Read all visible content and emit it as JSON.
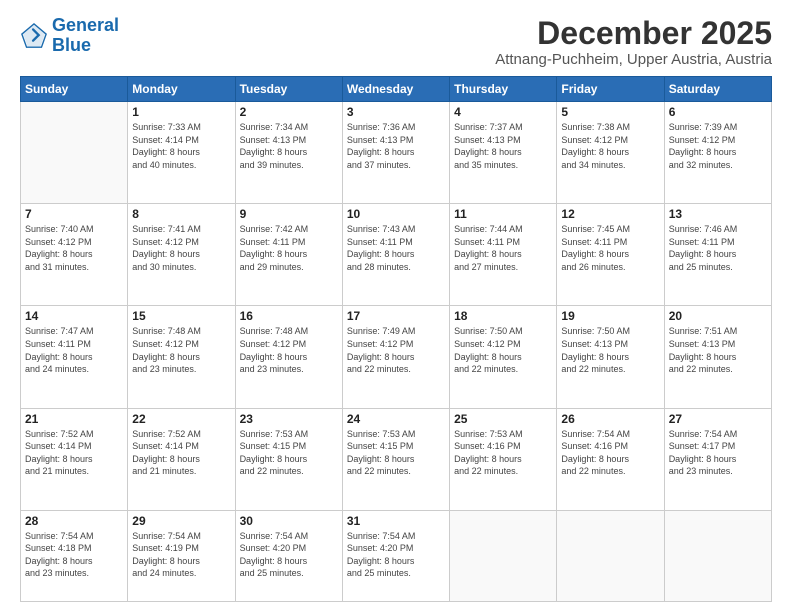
{
  "logo": {
    "line1": "General",
    "line2": "Blue"
  },
  "header": {
    "month": "December 2025",
    "location": "Attnang-Puchheim, Upper Austria, Austria"
  },
  "weekdays": [
    "Sunday",
    "Monday",
    "Tuesday",
    "Wednesday",
    "Thursday",
    "Friday",
    "Saturday"
  ],
  "weeks": [
    [
      {
        "day": "",
        "info": ""
      },
      {
        "day": "1",
        "info": "Sunrise: 7:33 AM\nSunset: 4:14 PM\nDaylight: 8 hours\nand 40 minutes."
      },
      {
        "day": "2",
        "info": "Sunrise: 7:34 AM\nSunset: 4:13 PM\nDaylight: 8 hours\nand 39 minutes."
      },
      {
        "day": "3",
        "info": "Sunrise: 7:36 AM\nSunset: 4:13 PM\nDaylight: 8 hours\nand 37 minutes."
      },
      {
        "day": "4",
        "info": "Sunrise: 7:37 AM\nSunset: 4:13 PM\nDaylight: 8 hours\nand 35 minutes."
      },
      {
        "day": "5",
        "info": "Sunrise: 7:38 AM\nSunset: 4:12 PM\nDaylight: 8 hours\nand 34 minutes."
      },
      {
        "day": "6",
        "info": "Sunrise: 7:39 AM\nSunset: 4:12 PM\nDaylight: 8 hours\nand 32 minutes."
      }
    ],
    [
      {
        "day": "7",
        "info": "Sunrise: 7:40 AM\nSunset: 4:12 PM\nDaylight: 8 hours\nand 31 minutes."
      },
      {
        "day": "8",
        "info": "Sunrise: 7:41 AM\nSunset: 4:12 PM\nDaylight: 8 hours\nand 30 minutes."
      },
      {
        "day": "9",
        "info": "Sunrise: 7:42 AM\nSunset: 4:11 PM\nDaylight: 8 hours\nand 29 minutes."
      },
      {
        "day": "10",
        "info": "Sunrise: 7:43 AM\nSunset: 4:11 PM\nDaylight: 8 hours\nand 28 minutes."
      },
      {
        "day": "11",
        "info": "Sunrise: 7:44 AM\nSunset: 4:11 PM\nDaylight: 8 hours\nand 27 minutes."
      },
      {
        "day": "12",
        "info": "Sunrise: 7:45 AM\nSunset: 4:11 PM\nDaylight: 8 hours\nand 26 minutes."
      },
      {
        "day": "13",
        "info": "Sunrise: 7:46 AM\nSunset: 4:11 PM\nDaylight: 8 hours\nand 25 minutes."
      }
    ],
    [
      {
        "day": "14",
        "info": "Sunrise: 7:47 AM\nSunset: 4:11 PM\nDaylight: 8 hours\nand 24 minutes."
      },
      {
        "day": "15",
        "info": "Sunrise: 7:48 AM\nSunset: 4:12 PM\nDaylight: 8 hours\nand 23 minutes."
      },
      {
        "day": "16",
        "info": "Sunrise: 7:48 AM\nSunset: 4:12 PM\nDaylight: 8 hours\nand 23 minutes."
      },
      {
        "day": "17",
        "info": "Sunrise: 7:49 AM\nSunset: 4:12 PM\nDaylight: 8 hours\nand 22 minutes."
      },
      {
        "day": "18",
        "info": "Sunrise: 7:50 AM\nSunset: 4:12 PM\nDaylight: 8 hours\nand 22 minutes."
      },
      {
        "day": "19",
        "info": "Sunrise: 7:50 AM\nSunset: 4:13 PM\nDaylight: 8 hours\nand 22 minutes."
      },
      {
        "day": "20",
        "info": "Sunrise: 7:51 AM\nSunset: 4:13 PM\nDaylight: 8 hours\nand 22 minutes."
      }
    ],
    [
      {
        "day": "21",
        "info": "Sunrise: 7:52 AM\nSunset: 4:14 PM\nDaylight: 8 hours\nand 21 minutes."
      },
      {
        "day": "22",
        "info": "Sunrise: 7:52 AM\nSunset: 4:14 PM\nDaylight: 8 hours\nand 21 minutes."
      },
      {
        "day": "23",
        "info": "Sunrise: 7:53 AM\nSunset: 4:15 PM\nDaylight: 8 hours\nand 22 minutes."
      },
      {
        "day": "24",
        "info": "Sunrise: 7:53 AM\nSunset: 4:15 PM\nDaylight: 8 hours\nand 22 minutes."
      },
      {
        "day": "25",
        "info": "Sunrise: 7:53 AM\nSunset: 4:16 PM\nDaylight: 8 hours\nand 22 minutes."
      },
      {
        "day": "26",
        "info": "Sunrise: 7:54 AM\nSunset: 4:16 PM\nDaylight: 8 hours\nand 22 minutes."
      },
      {
        "day": "27",
        "info": "Sunrise: 7:54 AM\nSunset: 4:17 PM\nDaylight: 8 hours\nand 23 minutes."
      }
    ],
    [
      {
        "day": "28",
        "info": "Sunrise: 7:54 AM\nSunset: 4:18 PM\nDaylight: 8 hours\nand 23 minutes."
      },
      {
        "day": "29",
        "info": "Sunrise: 7:54 AM\nSunset: 4:19 PM\nDaylight: 8 hours\nand 24 minutes."
      },
      {
        "day": "30",
        "info": "Sunrise: 7:54 AM\nSunset: 4:20 PM\nDaylight: 8 hours\nand 25 minutes."
      },
      {
        "day": "31",
        "info": "Sunrise: 7:54 AM\nSunset: 4:20 PM\nDaylight: 8 hours\nand 25 minutes."
      },
      {
        "day": "",
        "info": ""
      },
      {
        "day": "",
        "info": ""
      },
      {
        "day": "",
        "info": ""
      }
    ]
  ]
}
